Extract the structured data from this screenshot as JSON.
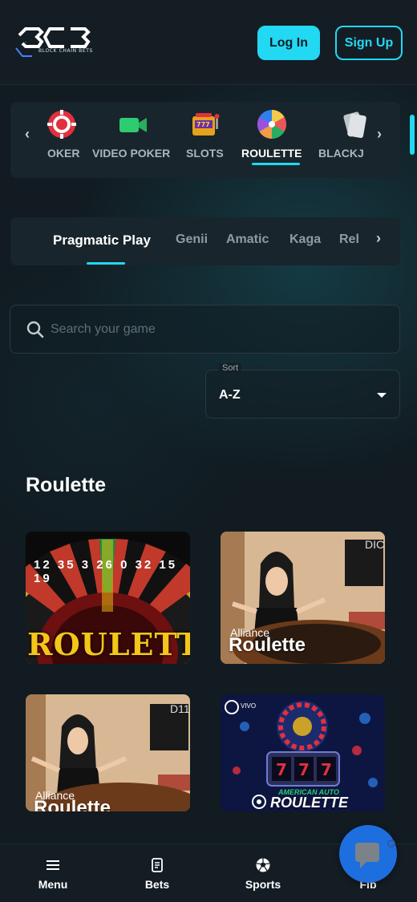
{
  "header": {
    "logo_text": "BCB",
    "logo_subtitle": "BLOCK CHAIN BETS",
    "login_label": "Log In",
    "signup_label": "Sign Up"
  },
  "categories": {
    "items": [
      {
        "label": "OKER",
        "icon": "poker-chip-icon"
      },
      {
        "label": "VIDEO POKER",
        "icon": "video-camera-icon"
      },
      {
        "label": "SLOTS",
        "icon": "slot-machine-icon"
      },
      {
        "label": "ROULETTE",
        "icon": "roulette-wheel-icon",
        "active": true
      },
      {
        "label": "BLACKJ",
        "icon": "cards-icon"
      }
    ]
  },
  "providers": {
    "items": [
      "Pragmatic Play",
      "Genii",
      "Amatic",
      "Kaga",
      "Rel"
    ],
    "active": "Pragmatic Play"
  },
  "search": {
    "placeholder": "Search your game"
  },
  "sort": {
    "label": "Sort",
    "value": "A-Z"
  },
  "section": {
    "title": "Roulette"
  },
  "games": [
    {
      "caption": "ROULETTE",
      "wheel_numbers": "12 35 3 26 0 32 15 19"
    },
    {
      "caption_small": "Alliance",
      "caption_big": "Roulette",
      "corner": "DIC"
    },
    {
      "caption_small": "Alliance",
      "caption_big": "Roulette",
      "corner": "D11"
    },
    {
      "brand": "VIVO",
      "banner": "AMERICAN AUTO",
      "caption": "ROULETTE"
    }
  ],
  "bottom_nav": {
    "items": [
      {
        "label": "Menu",
        "icon": "menu-icon"
      },
      {
        "label": "Bets",
        "icon": "bets-icon"
      },
      {
        "label": "Sports",
        "icon": "sports-ball-icon"
      },
      {
        "label": "Fib",
        "icon": "chat-icon"
      }
    ]
  },
  "colors": {
    "accent": "#22d8f2",
    "background": "#111b21",
    "panel": "#18252c",
    "chat": "#1d6fe0"
  }
}
